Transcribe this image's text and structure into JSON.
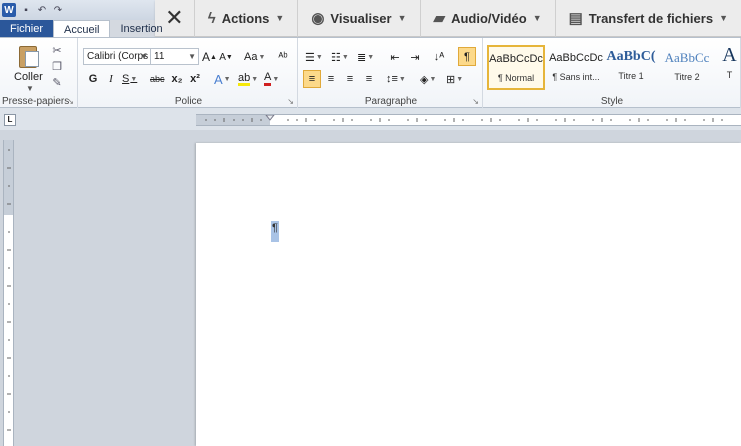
{
  "title_bar": {
    "app_icon": "word-icon",
    "qat_icons": [
      "save-icon",
      "undo-icon",
      "redo-icon"
    ]
  },
  "remote_toolbar": {
    "close_icon": "close-icon",
    "items": [
      {
        "icon": "lightning-icon",
        "label": "Actions"
      },
      {
        "icon": "eye-icon",
        "label": "Visualiser"
      },
      {
        "icon": "chat-bubbles-icon",
        "label": "Audio/Vidéo"
      },
      {
        "icon": "file-transfer-icon",
        "label": "Transfert de fichiers"
      }
    ]
  },
  "tabs": {
    "file": "Fichier",
    "home": "Accueil",
    "insert": "Insertion"
  },
  "clipboard": {
    "paste_label": "Coller",
    "group_label": "Presse-papiers"
  },
  "font": {
    "font_name": "Calibri (Corps",
    "font_size": "11",
    "grow": "A",
    "shrink": "A",
    "change_case": "Aa",
    "bold": "G",
    "italic": "I",
    "underline": "S",
    "strike": "abc",
    "subscript": "x₂",
    "superscript": "x²",
    "text_effects": "A",
    "font_color": "A",
    "group_label": "Police"
  },
  "paragraph": {
    "group_label": "Paragraphe",
    "show_marks": "¶"
  },
  "styles": {
    "group_label": "Style",
    "items": [
      {
        "sample": "AaBbCcDc",
        "name": "¶ Normal"
      },
      {
        "sample": "AaBbCcDc",
        "name": "¶ Sans int..."
      },
      {
        "sample": "AaBbC(",
        "name": "Titre 1"
      },
      {
        "sample": "AaBbCc",
        "name": "Titre 2"
      },
      {
        "sample": "A",
        "name": "T"
      }
    ]
  },
  "ruler": {
    "tab_selector": "L"
  },
  "document": {
    "paragraph_mark": "¶"
  },
  "colors": {
    "accent": "#2b579a",
    "selected_style_border": "#e6b53a",
    "heading_blue": "#2e5c99",
    "font_color_bar": "#d02020",
    "highlight_bar": "#f6e90a"
  }
}
